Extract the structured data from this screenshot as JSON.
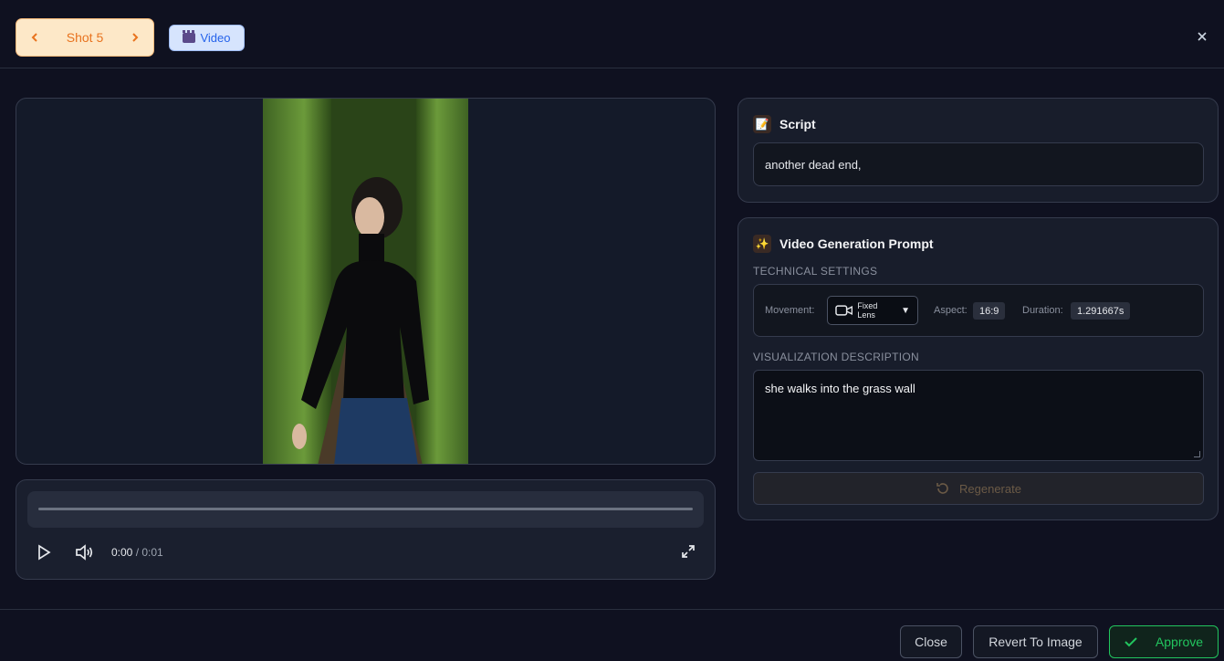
{
  "header": {
    "shot_label": "Shot 5",
    "badge_label": "Video"
  },
  "player": {
    "current_time": "0:00",
    "duration": "/ 0:01",
    "progress": 0
  },
  "script": {
    "title": "Script",
    "text": "another dead end,"
  },
  "prompt": {
    "title": "Video Generation Prompt",
    "technical_label": "TECHNICAL SETTINGS",
    "movement_label": "Movement:",
    "movement_value": "Fixed Lens",
    "aspect_label": "Aspect:",
    "aspect_value": "16:9",
    "duration_label": "Duration:",
    "duration_value": "1.291667s",
    "visualization_label": "VISUALIZATION DESCRIPTION",
    "visualization_text": "she walks into the grass wall",
    "regenerate_label": "Regenerate"
  },
  "footer": {
    "close_label": "Close",
    "revert_label": "Revert To Image",
    "approve_label": "Approve"
  },
  "colors": {
    "background": "#0f1120",
    "shot_accent": "#e8731f",
    "video_badge": "#2563eb",
    "approve": "#22c55e"
  }
}
